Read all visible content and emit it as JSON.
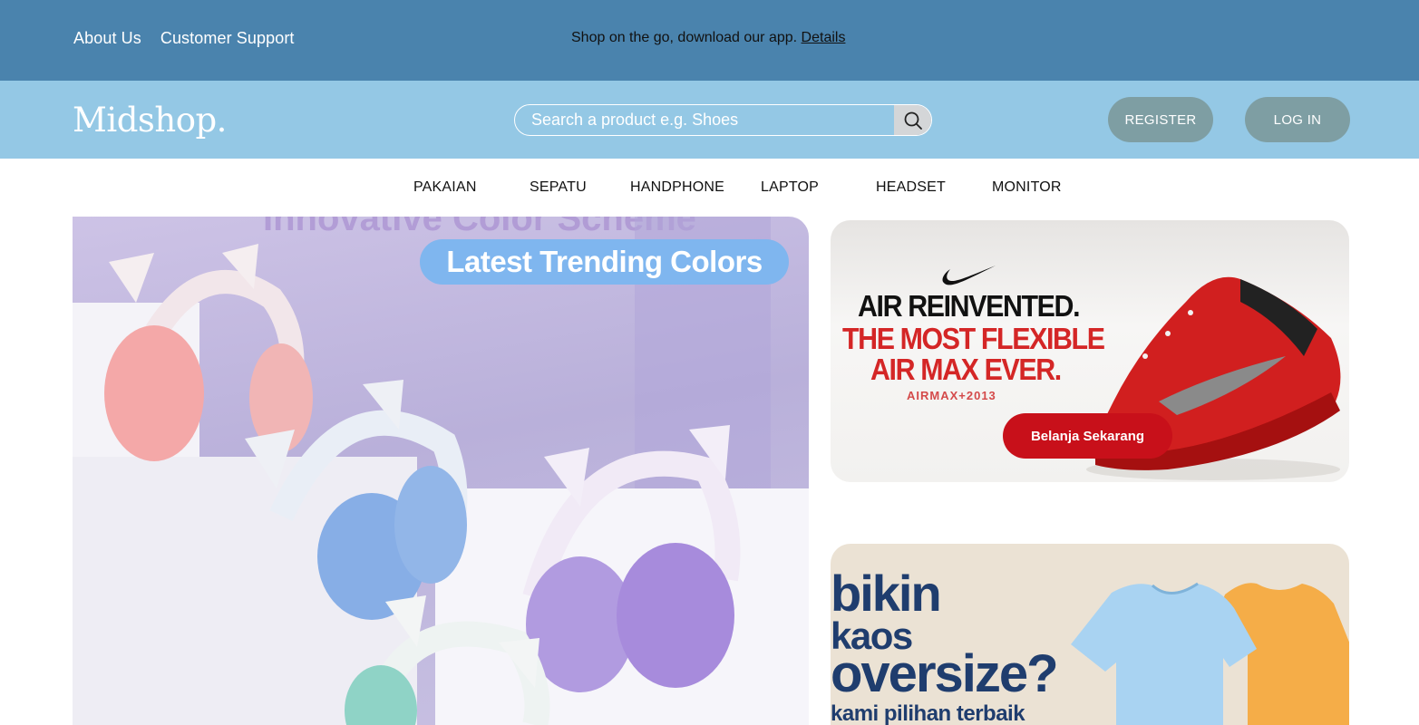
{
  "topbar": {
    "links": [
      "About Us",
      "Customer Support"
    ],
    "promo_text": "Shop on the go, download our app.",
    "promo_link": "Details"
  },
  "header": {
    "logo": "Midshop.",
    "search_placeholder": "Search a product e.g. Shoes",
    "register_label": "REGISTER",
    "login_label": "LOG IN"
  },
  "categories": [
    "PAKAIAN",
    "SEPATU",
    "HANDPHONE",
    "LAPTOP",
    "HEADSET",
    "MONITOR"
  ],
  "hero": {
    "badge": "Latest Trending Colors",
    "partial_top_text": "Innovative Color Scheme"
  },
  "ad_nike": {
    "line1": "AIR REINVENTED.",
    "line2": "THE MOST FLEXIBLE",
    "line3": "AIR MAX EVER.",
    "line4": "AIRMAX+2013",
    "cta": "Belanja Sekarang"
  },
  "ad_kaos": {
    "line1": "bikin",
    "line2": "kaos",
    "line3": "oversize?",
    "line4": "kami pilihan terbaik"
  },
  "colors": {
    "topbar": "#4a83ad",
    "header": "#94c8e5",
    "pill_button": "#7e9ea3",
    "cta_red": "#c8101a"
  }
}
